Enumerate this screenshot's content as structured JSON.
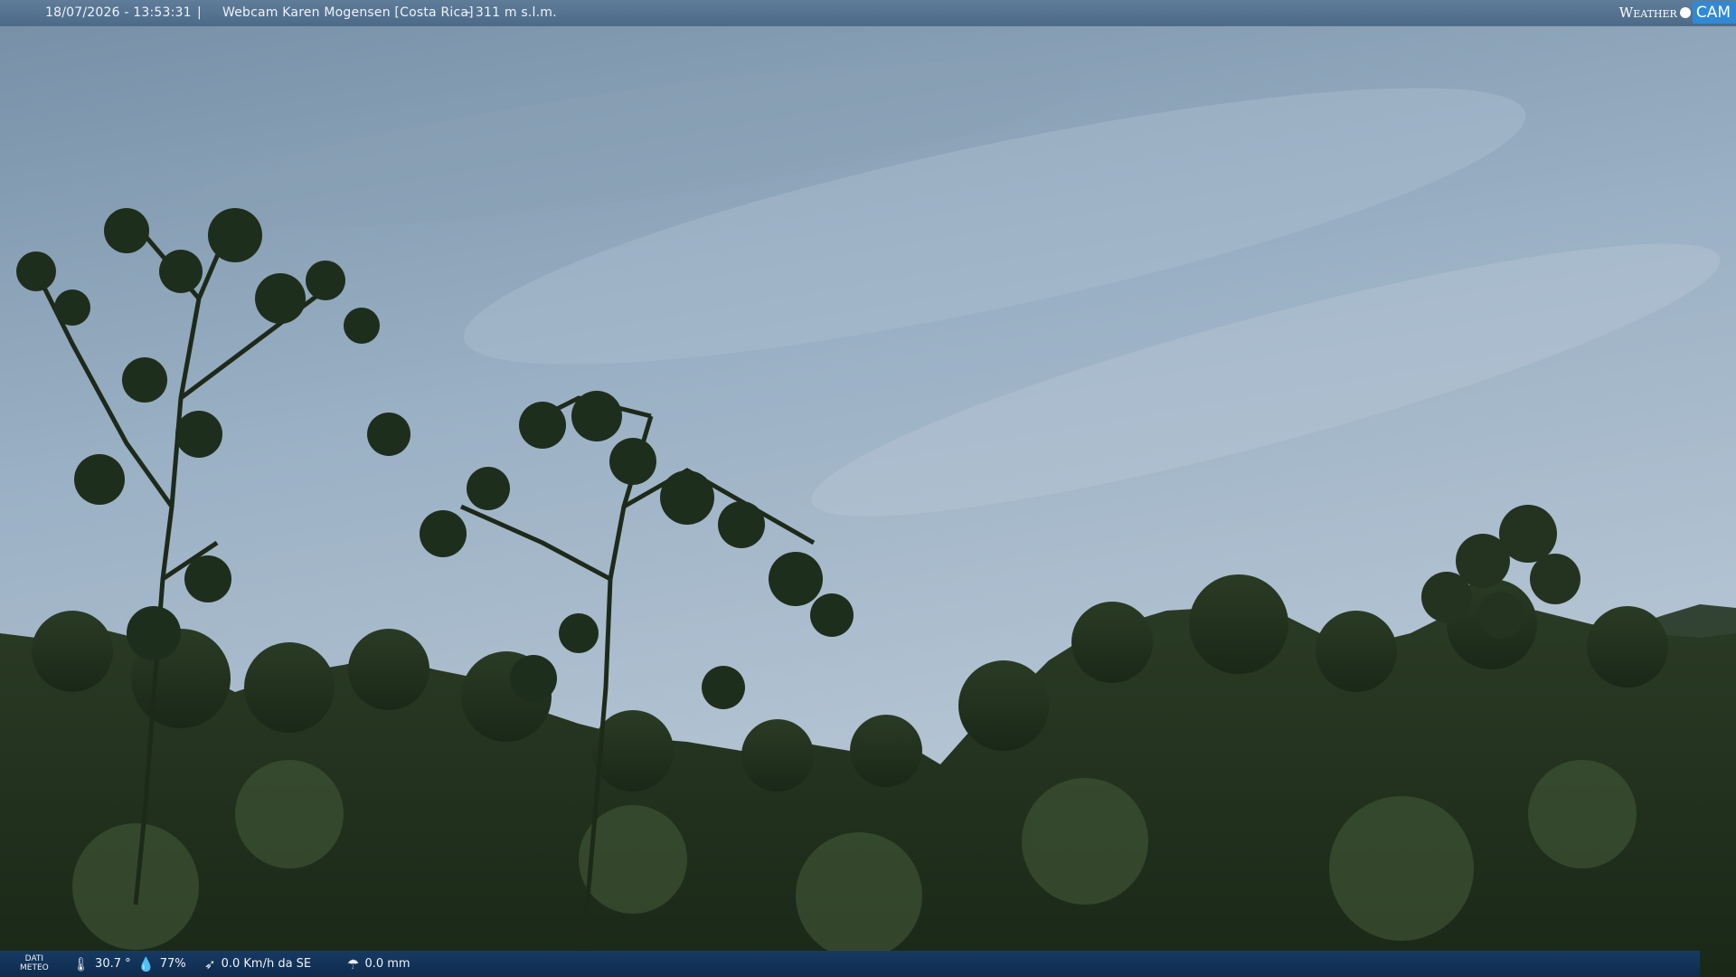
{
  "header": {
    "datetime": "18/07/2026 - 13:53:31",
    "separator": "|",
    "title": "Webcam Karen Mogensen [Costa Rica]",
    "altitude": "- 311 m s.l.m.",
    "logo": {
      "weather": "Weather",
      "cam": "CAM"
    }
  },
  "footer": {
    "dati_label_1": "DATI",
    "dati_label_2": "METEO",
    "temperature": "30.7 °",
    "humidity": "77%",
    "wind": "0.0 Km/h da SE",
    "rain": "0.0 mm",
    "icons": [
      "thermometer-icon",
      "humidity-icon",
      "wind-icon",
      "rain-icon"
    ]
  },
  "colors": {
    "sky": "#8ea7bd",
    "forest": "#1f2f1d",
    "top_bar": "#56738f",
    "bottom_bar": "#12325a",
    "logo_accent": "#2f8ad6"
  }
}
